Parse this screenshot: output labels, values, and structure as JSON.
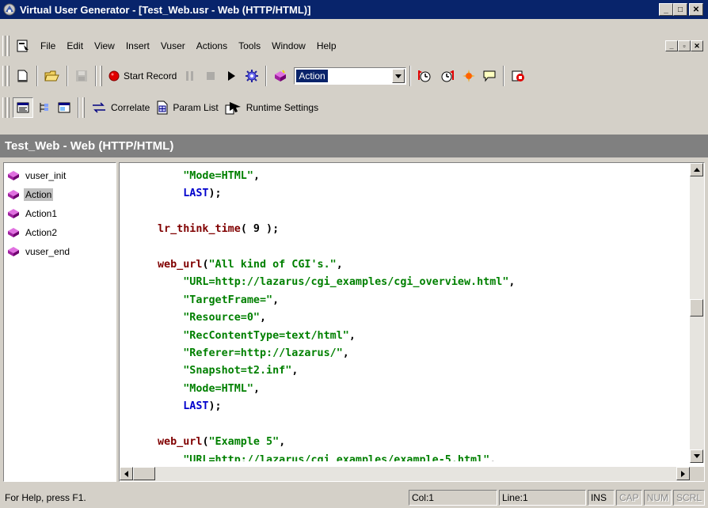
{
  "window": {
    "title": "Virtual User Generator - [Test_Web.usr - Web (HTTP/HTML)]",
    "minimize_label": "_",
    "maximize_label": "□",
    "close_label": "✕"
  },
  "menu": {
    "items": [
      "File",
      "Edit",
      "View",
      "Insert",
      "Vuser",
      "Actions",
      "Tools",
      "Window",
      "Help"
    ],
    "mdi_minimize": "_",
    "mdi_restore": "▫",
    "mdi_close": "✕"
  },
  "toolbar": {
    "start_record_label": "Start Record",
    "action_select_value": "Action",
    "correlate_label": "Correlate",
    "param_list_label": "Param List",
    "runtime_settings_label": "Runtime Settings"
  },
  "document": {
    "header": "Test_Web - Web (HTTP/HTML)"
  },
  "tree": {
    "items": [
      "vuser_init",
      "Action",
      "Action1",
      "Action2",
      "vuser_end"
    ],
    "selected": "Action"
  },
  "editor": {
    "lines": [
      {
        "indent": "    ",
        "parts": [
          {
            "t": "\"Mode=HTML\"",
            "c": "str"
          },
          {
            "t": ",",
            "c": "pun"
          }
        ]
      },
      {
        "indent": "    ",
        "parts": [
          {
            "t": "LAST",
            "c": "kw"
          },
          {
            "t": ");",
            "c": "pun"
          }
        ]
      },
      {
        "indent": "",
        "parts": []
      },
      {
        "indent": "",
        "parts": [
          {
            "t": "lr_think_time",
            "c": "fn"
          },
          {
            "t": "( 9 );",
            "c": "pun"
          }
        ]
      },
      {
        "indent": "",
        "parts": []
      },
      {
        "indent": "",
        "parts": [
          {
            "t": "web_url",
            "c": "fn"
          },
          {
            "t": "(",
            "c": "pun"
          },
          {
            "t": "\"All kind of CGI's.\"",
            "c": "str"
          },
          {
            "t": ",",
            "c": "pun"
          }
        ]
      },
      {
        "indent": "    ",
        "parts": [
          {
            "t": "\"URL=http://lazarus/cgi_examples/cgi_overview.html\"",
            "c": "str"
          },
          {
            "t": ",",
            "c": "pun"
          }
        ]
      },
      {
        "indent": "    ",
        "parts": [
          {
            "t": "\"TargetFrame=\"",
            "c": "str"
          },
          {
            "t": ",",
            "c": "pun"
          }
        ]
      },
      {
        "indent": "    ",
        "parts": [
          {
            "t": "\"Resource=0\"",
            "c": "str"
          },
          {
            "t": ",",
            "c": "pun"
          }
        ]
      },
      {
        "indent": "    ",
        "parts": [
          {
            "t": "\"RecContentType=text/html\"",
            "c": "str"
          },
          {
            "t": ",",
            "c": "pun"
          }
        ]
      },
      {
        "indent": "    ",
        "parts": [
          {
            "t": "\"Referer=http://lazarus/\"",
            "c": "str"
          },
          {
            "t": ",",
            "c": "pun"
          }
        ]
      },
      {
        "indent": "    ",
        "parts": [
          {
            "t": "\"Snapshot=t2.inf\"",
            "c": "str"
          },
          {
            "t": ",",
            "c": "pun"
          }
        ]
      },
      {
        "indent": "    ",
        "parts": [
          {
            "t": "\"Mode=HTML\"",
            "c": "str"
          },
          {
            "t": ",",
            "c": "pun"
          }
        ]
      },
      {
        "indent": "    ",
        "parts": [
          {
            "t": "LAST",
            "c": "kw"
          },
          {
            "t": ");",
            "c": "pun"
          }
        ]
      },
      {
        "indent": "",
        "parts": []
      },
      {
        "indent": "",
        "parts": [
          {
            "t": "web_url",
            "c": "fn"
          },
          {
            "t": "(",
            "c": "pun"
          },
          {
            "t": "\"Example 5\"",
            "c": "str"
          },
          {
            "t": ",",
            "c": "pun"
          }
        ]
      },
      {
        "indent": "    ",
        "parts": [
          {
            "t": "\"URL=http://lazarus/cgi_examples/example-5.html\"",
            "c": "str"
          },
          {
            "t": ",",
            "c": "pun"
          }
        ]
      }
    ]
  },
  "status": {
    "help_text": "For Help, press F1.",
    "col": "Col:1",
    "line": "Line:1",
    "ins": "INS",
    "cap": "CAP",
    "num": "NUM",
    "scrl": "SCRL"
  },
  "colors": {
    "title_bar": "#08246b",
    "function": "#800000",
    "string": "#008000",
    "keyword": "#0000cc",
    "record_red": "#e00000"
  },
  "icons": {
    "app": "vugen-app-icon",
    "document": "document-icon",
    "new": "new-file-icon",
    "open": "open-folder-icon",
    "save": "save-disk-icon",
    "record": "record-dot-icon",
    "pause": "pause-icon",
    "stop": "stop-icon",
    "run": "play-icon",
    "compile": "gear-icon",
    "action": "action-cube-icon",
    "transaction_start": "transaction-start-icon",
    "transaction_end": "transaction-end-icon",
    "rendezvous": "rendezvous-icon",
    "comment": "comment-bubble-icon",
    "snapshot": "snapshot-icon",
    "script_view": "script-view-icon",
    "tree_view": "tree-view-icon",
    "output_window": "output-window-icon",
    "correlate": "correlate-icon",
    "param_list": "param-list-icon",
    "runtime_settings": "runtime-settings-icon"
  }
}
